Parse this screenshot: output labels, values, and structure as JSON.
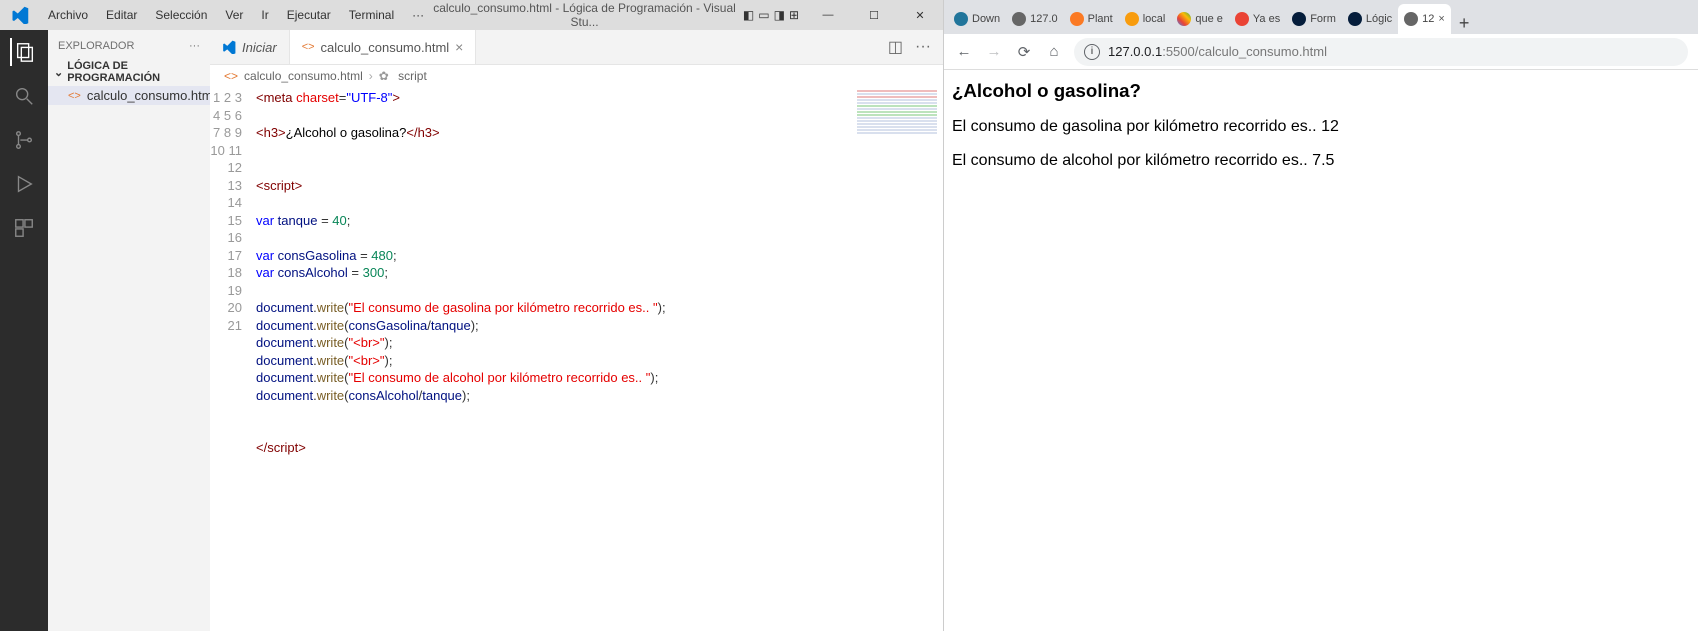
{
  "vscode": {
    "menus": [
      "Archivo",
      "Editar",
      "Selección",
      "Ver",
      "Ir",
      "Ejecutar",
      "Terminal",
      "···"
    ],
    "title": "calculo_consumo.html - Lógica de Programación - Visual Stu...",
    "sidebar": {
      "title": "EXPLORADOR",
      "section": "LÓGICA DE PROGRAMACIÓN",
      "file": "calculo_consumo.html"
    },
    "tabs": {
      "inactive": "Iniciar",
      "active": "calculo_consumo.html"
    },
    "breadcrumb": {
      "file": "calculo_consumo.html",
      "part": "script"
    },
    "lines": [
      "1",
      "2",
      "3",
      "4",
      "5",
      "6",
      "7",
      "8",
      "9",
      "10",
      "11",
      "12",
      "13",
      "14",
      "15",
      "16",
      "17",
      "18",
      "19",
      "20",
      "21"
    ],
    "code": {
      "l1": {
        "tag_open": "<meta",
        "attr": " charset",
        "eq": "=",
        "str": "\"UTF-8\"",
        "tag_close": ">"
      },
      "l3": {
        "open": "<h3>",
        "text": "¿Alcohol o gasolina?",
        "close": "</h3>"
      },
      "l6": {
        "open": "<script>"
      },
      "l8": {
        "kw": "var",
        "name": " tanque ",
        "eq": "= ",
        "num": "40",
        "sc": ";"
      },
      "l10": {
        "kw": "var",
        "name": " consGasolina ",
        "eq": "= ",
        "num": "480",
        "sc": ";"
      },
      "l11": {
        "kw": "var",
        "name": " consAlcohol ",
        "eq": "= ",
        "num": "300",
        "sc": ";"
      },
      "l13": {
        "obj": "document",
        "dot": ".",
        "fn": "write",
        "p1": "(",
        "str": "\"El consumo de gasolina por kilómetro recorrido es.. \"",
        "p2": ");"
      },
      "l14": {
        "obj": "document",
        "dot": ".",
        "fn": "write",
        "p1": "(",
        "v1": "consGasolina",
        "op": "/",
        "v2": "tanque",
        "p2": ");"
      },
      "l15": {
        "obj": "document",
        "dot": ".",
        "fn": "write",
        "p1": "(",
        "str": "\"<br>\"",
        "p2": ");"
      },
      "l16": {
        "obj": "document",
        "dot": ".",
        "fn": "write",
        "p1": "(",
        "str": "\"<br>\"",
        "p2": ");"
      },
      "l17": {
        "obj": "document",
        "dot": ".",
        "fn": "write",
        "p1": "(",
        "str": "\"El consumo de alcohol por kilómetro recorrido es.. \"",
        "p2": ");"
      },
      "l18": {
        "obj": "document",
        "dot": ".",
        "fn": "write",
        "p1": "(",
        "v1": "consAlcohol",
        "op": "/",
        "v2": "tanque",
        "p2": ");"
      },
      "l21": {
        "close": "</script​>"
      }
    }
  },
  "browser": {
    "tabs": [
      {
        "fav": "wp",
        "label": "Down"
      },
      {
        "fav": "gl",
        "label": "127.0"
      },
      {
        "fav": "xa",
        "label": "Plant"
      },
      {
        "fav": "pma",
        "label": "local"
      },
      {
        "fav": "g",
        "label": "que e"
      },
      {
        "fav": "gm",
        "label": "Ya es"
      },
      {
        "fav": "al",
        "label": "Form"
      },
      {
        "fav": "al",
        "label": "Lógic"
      },
      {
        "fav": "gl",
        "label": "12",
        "active": true
      }
    ],
    "url_host": "127.0.0.1",
    "url_port": ":5500",
    "url_path": "/calculo_consumo.html",
    "page": {
      "h3": "¿Alcohol o gasolina?",
      "p1": "El consumo de gasolina por kilómetro recorrido es.. 12",
      "p2": "El consumo de alcohol por kilómetro recorrido es.. 7.5"
    }
  }
}
